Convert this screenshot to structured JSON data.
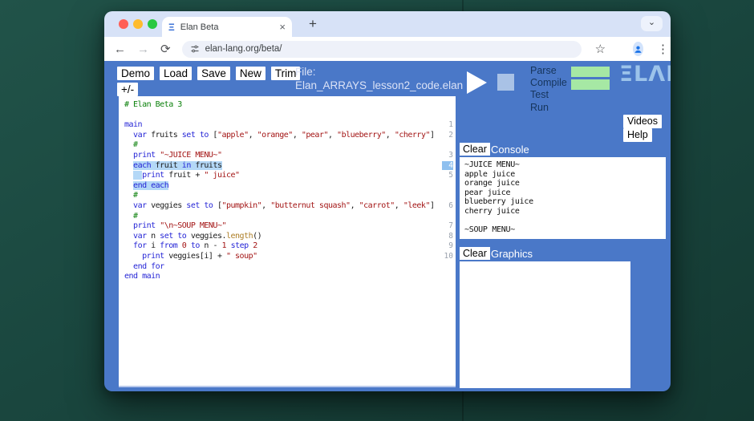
{
  "colors": {
    "app_background": "#4a78c8",
    "desktop_background": "#1a473f",
    "status_pass_green": "#a6e8a4",
    "selection_blue": "#b4d8f7",
    "logo_blue": "#9cc3ea",
    "keyword_blue": "#2525d6",
    "comment_green": "#0b800b",
    "string_red": "#a31515"
  },
  "browser": {
    "tab_title": "Elan Beta",
    "url": "elan-lang.org/beta/",
    "icons": {
      "back": "←",
      "forward": "→",
      "reload": "⟳",
      "star": "☆",
      "menu": "⋮",
      "close": "×",
      "new_tab": "+",
      "chevron": "⌄",
      "favicon": "Ξ"
    }
  },
  "toolbar": {
    "demo": "Demo",
    "load": "Load",
    "save": "Save",
    "new": "New",
    "trim": "Trim",
    "plusminus": "+/-"
  },
  "file": {
    "label": "File:",
    "name": "Elan_ARRAYS_lesson2_code.elan"
  },
  "run": {
    "steps": [
      "Parse",
      "Compile",
      "Test",
      "Run"
    ],
    "status_boxes": [
      {
        "step": "Parse",
        "color": "#a6e8a4"
      },
      {
        "step": "Compile",
        "color": "#a6e8a4"
      }
    ],
    "logo": "ΞLΛΠ"
  },
  "links": {
    "videos": "Videos",
    "help": "Help"
  },
  "console": {
    "clear": "Clear",
    "title": "Console",
    "lines": [
      "~JUICE MENU~",
      "apple juice",
      "orange juice",
      "pear juice",
      "blueberry juice",
      "cherry juice",
      "",
      "~SOUP MENU~"
    ]
  },
  "graphics": {
    "clear": "Clear",
    "title": "Graphics"
  },
  "editor": {
    "lines": [
      {
        "tokens": [
          [
            "c",
            "# Elan Beta 3"
          ]
        ]
      },
      {
        "tokens": []
      },
      {
        "num": "1",
        "tokens": [
          [
            "k",
            "main"
          ]
        ]
      },
      {
        "num": "2",
        "tokens": [
          [
            "p",
            "  "
          ],
          [
            "k",
            "var"
          ],
          [
            "p",
            " fruits "
          ],
          [
            "k",
            "set to"
          ],
          [
            "p",
            " ["
          ],
          [
            "s",
            "\"apple\""
          ],
          [
            "p",
            ", "
          ],
          [
            "s",
            "\"orange\""
          ],
          [
            "p",
            ", "
          ],
          [
            "s",
            "\"pear\""
          ],
          [
            "p",
            ", "
          ],
          [
            "s",
            "\"blueberry\""
          ],
          [
            "p",
            ", "
          ],
          [
            "s",
            "\"cherry\""
          ],
          [
            "p",
            "]"
          ]
        ]
      },
      {
        "tokens": [
          [
            "c",
            "  #"
          ]
        ]
      },
      {
        "num": "3",
        "tokens": [
          [
            "p",
            "  "
          ],
          [
            "k",
            "print"
          ],
          [
            "p",
            " "
          ],
          [
            "s",
            "\"~JUICE MENU~\""
          ]
        ]
      },
      {
        "num": "4",
        "numSel": true,
        "tokens": [
          [
            "p",
            "  "
          ],
          [
            "k",
            "each",
            "h"
          ],
          [
            "p",
            " fruit ",
            "h"
          ],
          [
            "k",
            "in",
            "h"
          ],
          [
            "p",
            " fruits",
            "h"
          ]
        ]
      },
      {
        "num": "5",
        "tokens": [
          [
            "p",
            "  "
          ],
          [
            "p",
            "  ",
            "h"
          ],
          [
            "k",
            "print"
          ],
          [
            "p",
            " fruit + "
          ],
          [
            "s",
            "\" juice\""
          ]
        ]
      },
      {
        "tokens": [
          [
            "p",
            "  "
          ],
          [
            "k",
            "end each",
            "h"
          ]
        ]
      },
      {
        "tokens": [
          [
            "c",
            "  #"
          ]
        ]
      },
      {
        "num": "6",
        "tokens": [
          [
            "p",
            "  "
          ],
          [
            "k",
            "var"
          ],
          [
            "p",
            " veggies "
          ],
          [
            "k",
            "set to"
          ],
          [
            "p",
            " ["
          ],
          [
            "s",
            "\"pumpkin\""
          ],
          [
            "p",
            ", "
          ],
          [
            "s",
            "\"butternut squash\""
          ],
          [
            "p",
            ", "
          ],
          [
            "s",
            "\"carrot\""
          ],
          [
            "p",
            ", "
          ],
          [
            "s",
            "\"leek\""
          ],
          [
            "p",
            "]"
          ]
        ]
      },
      {
        "tokens": [
          [
            "c",
            "  #"
          ]
        ]
      },
      {
        "num": "7",
        "tokens": [
          [
            "p",
            "  "
          ],
          [
            "k",
            "print"
          ],
          [
            "p",
            " "
          ],
          [
            "s",
            "\"\\n~SOUP MENU~\""
          ]
        ]
      },
      {
        "num": "8",
        "tokens": [
          [
            "p",
            "  "
          ],
          [
            "k",
            "var"
          ],
          [
            "p",
            " n "
          ],
          [
            "k",
            "set to"
          ],
          [
            "p",
            " veggies."
          ],
          [
            "m",
            "length"
          ],
          [
            "p",
            "()"
          ]
        ]
      },
      {
        "num": "9",
        "tokens": [
          [
            "p",
            "  "
          ],
          [
            "k",
            "for"
          ],
          [
            "p",
            " i "
          ],
          [
            "k",
            "from"
          ],
          [
            "p",
            " "
          ],
          [
            "n",
            "0"
          ],
          [
            "p",
            " "
          ],
          [
            "k",
            "to"
          ],
          [
            "p",
            " n - "
          ],
          [
            "n",
            "1"
          ],
          [
            "p",
            " "
          ],
          [
            "k",
            "step"
          ],
          [
            "p",
            " "
          ],
          [
            "n",
            "2"
          ]
        ]
      },
      {
        "num": "10",
        "tokens": [
          [
            "p",
            "    "
          ],
          [
            "k",
            "print"
          ],
          [
            "p",
            " veggies[i] + "
          ],
          [
            "s",
            "\" soup\""
          ]
        ]
      },
      {
        "tokens": [
          [
            "p",
            "  "
          ],
          [
            "k",
            "end for"
          ]
        ]
      },
      {
        "tokens": [
          [
            "k",
            "end main"
          ]
        ]
      }
    ]
  }
}
